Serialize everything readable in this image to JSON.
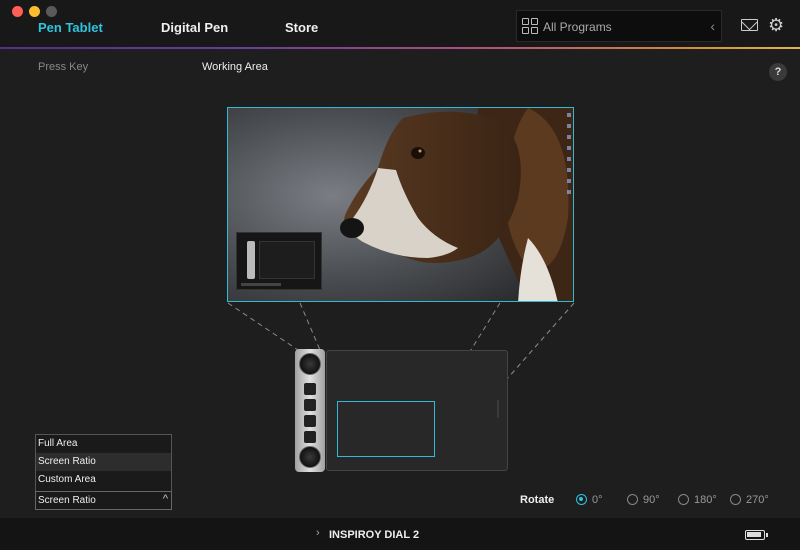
{
  "nav": {
    "tabs": [
      {
        "label": "Pen Tablet",
        "active": true
      },
      {
        "label": "Digital Pen",
        "active": false
      },
      {
        "label": "Store",
        "active": false
      }
    ],
    "program_selector": {
      "label": "All Programs",
      "icon": "grid-icon"
    },
    "icons": [
      "mail-icon",
      "gear-icon"
    ]
  },
  "subnav": {
    "press_key": "Press Key",
    "working_area": "Working Area",
    "help": "?"
  },
  "area_menu": {
    "options": [
      "Full Area",
      "Screen Ratio",
      "Custom Area"
    ],
    "selected": "Screen Ratio"
  },
  "rotate": {
    "label": "Rotate",
    "options": [
      "0°",
      "90°",
      "180°",
      "270°"
    ],
    "selected": "0°"
  },
  "footer": {
    "device_name": "INSPIROY DIAL 2",
    "battery_icon": "battery-icon"
  },
  "colors": {
    "accent": "#2ec4de",
    "background": "#1e1e1e"
  }
}
